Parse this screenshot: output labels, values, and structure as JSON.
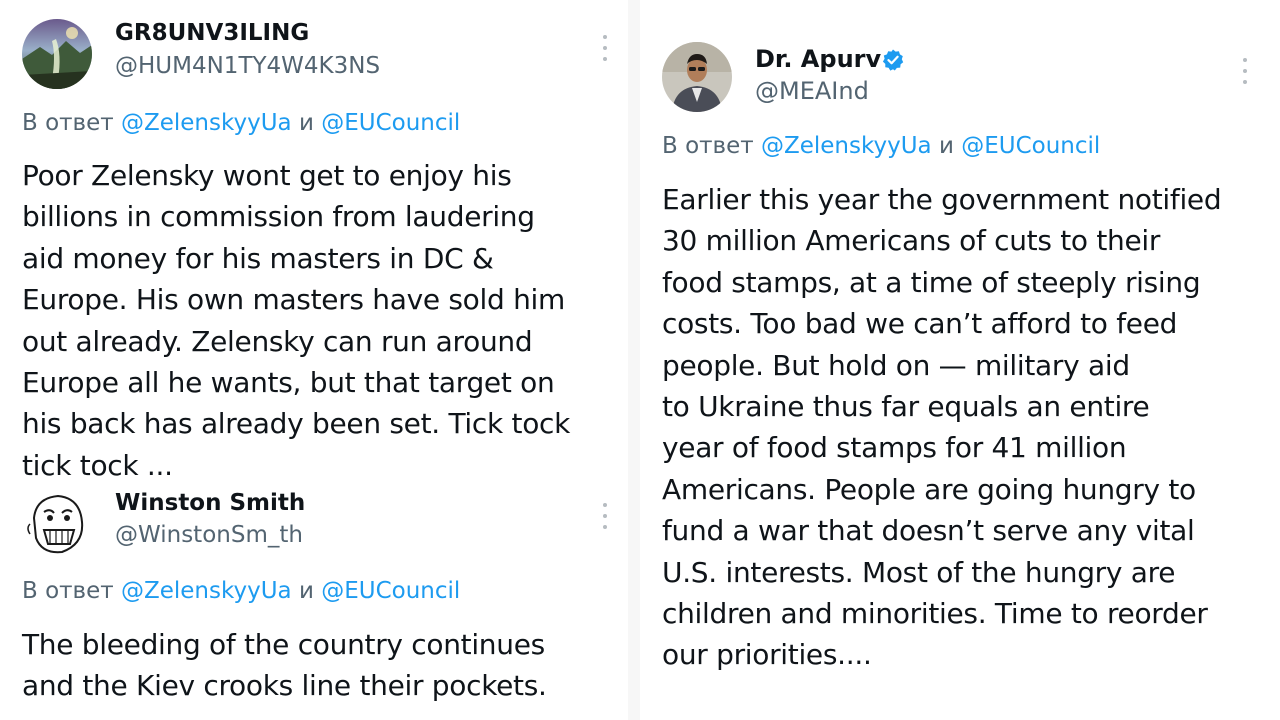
{
  "tweets": [
    {
      "display_name": "GR8UNV3ILING",
      "handle": "@HUM4N1TY4W4K3NS",
      "reply_prefix": "В ответ",
      "reply_mention_1": "@ZelenskyyUa",
      "reply_conj": "и",
      "reply_mention_2": "@EUCouncil",
      "lines": [
        "Poor Zelensky wont get to enjoy his",
        "billions in commission from laudering",
        "aid money for his masters in DC &",
        "Europe. His own masters have sold him",
        "out already.  Zelensky can run around",
        "Europe all he wants, but that target on",
        "his back has already been set. Tick tock",
        "tick tock ..."
      ]
    },
    {
      "display_name": "Winston Smith",
      "handle": "@WinstonSm_th",
      "reply_prefix": "В ответ",
      "reply_mention_1": "@ZelenskyyUa",
      "reply_conj": "и",
      "reply_mention_2": "@EUCouncil",
      "lines": [
        "The bleeding of the country continues",
        "and the Kiev crooks line their pockets."
      ]
    },
    {
      "display_name": "Dr. Apurv",
      "handle": "@MEAInd",
      "verified": true,
      "reply_prefix": "В ответ",
      "reply_mention_1": "@ZelenskyyUa",
      "reply_conj": "и",
      "reply_mention_2": "@EUCouncil",
      "lines": [
        "Earlier this year the government notified",
        "30 million Americans of cuts to their",
        "food stamps, at a time of steeply rising",
        "costs. Too bad we can’t afford to feed",
        "people. But hold on — military aid",
        "to Ukraine thus far equals an entire",
        "year of food stamps for 41 million",
        "Americans. People are going hungry to",
        "fund a war that doesn’t serve any vital",
        "U.S. interests. Most of the hungry are",
        "children and minorities. Time to reorder",
        "our priorities...."
      ]
    }
  ],
  "icons": {
    "more": "more-options-icon",
    "verified": "verified-badge-icon"
  },
  "colors": {
    "text": "#0f1419",
    "secondary": "#536471",
    "link": "#1d9bf0",
    "verified": "#1d9bf0"
  }
}
